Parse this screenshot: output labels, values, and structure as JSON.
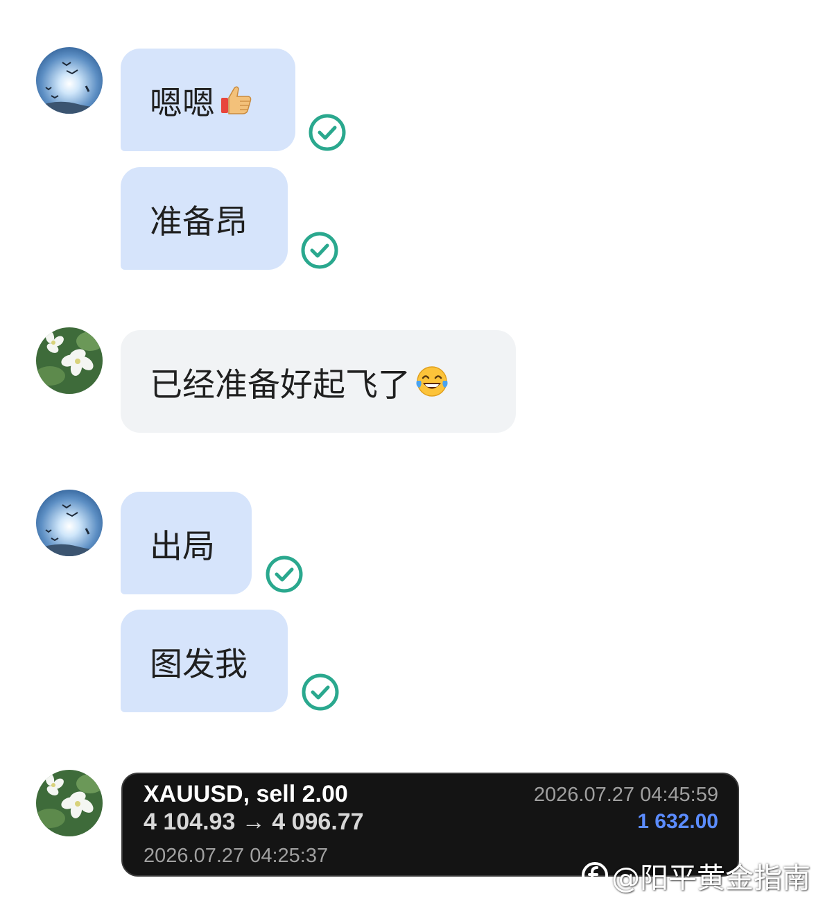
{
  "chat": {
    "messages": [
      {
        "sender": "self",
        "text": "嗯嗯",
        "emoji": "thumbs-up",
        "status": "sent"
      },
      {
        "sender": "self",
        "text": "准备昂",
        "status": "sent"
      },
      {
        "sender": "other",
        "text": "已经准备好起飞了",
        "emoji": "tears-of-joy"
      },
      {
        "sender": "self",
        "text": "出局",
        "status": "sent"
      },
      {
        "sender": "self",
        "text": "图发我",
        "status": "sent"
      }
    ],
    "trade": {
      "symbol": "XAUUSD,",
      "side": "sell 2.00",
      "prices": "4 104.93 → 4 096.77",
      "open_time": "2026.07.27 04:25:37",
      "close_time": "2026.07.27 04:45:59",
      "profit": "1 632.00"
    }
  },
  "watermark": {
    "text": "@阳平黄金指南"
  },
  "colors": {
    "outgoing_bubble": "#d6e4fb",
    "incoming_bubble": "#f1f3f5",
    "check": "#2aa88e",
    "sell": "#e23b3b",
    "profit": "#5b8cff"
  },
  "icons": [
    "sky-birds-avatar",
    "white-flower-avatar",
    "check-circle-icon",
    "thumbs-up-emoji",
    "tears-of-joy-emoji"
  ]
}
